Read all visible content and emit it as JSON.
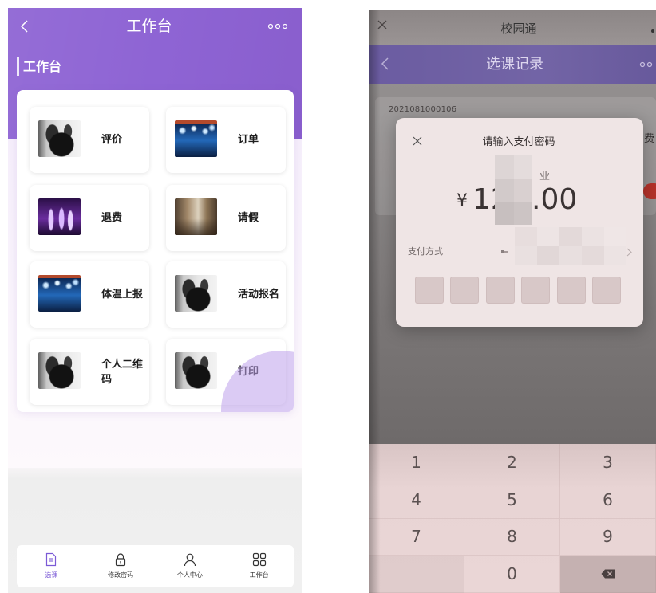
{
  "left_phone": {
    "header": {
      "back_icon": "chevron-left-icon",
      "title": "工作台",
      "more_icon": "more-dots-icon"
    },
    "section_title": "工作台",
    "grid": [
      {
        "label": "评价",
        "image": "camera-photo"
      },
      {
        "label": "订单",
        "image": "stage-photo"
      },
      {
        "label": "退费",
        "image": "dance-photo"
      },
      {
        "label": "请假",
        "image": "interior-photo"
      },
      {
        "label": "体温上报",
        "image": "stage-photo"
      },
      {
        "label": "活动报名",
        "image": "camera-photo"
      },
      {
        "label": "个人二维码",
        "image": "camera-photo"
      },
      {
        "label": "打印",
        "image": "camera-photo"
      }
    ],
    "bottom_nav": [
      {
        "label": "选课",
        "icon": "document-icon",
        "active": true
      },
      {
        "label": "修改密码",
        "icon": "lock-icon",
        "active": false
      },
      {
        "label": "个人中心",
        "icon": "person-icon",
        "active": false
      },
      {
        "label": "工作台",
        "icon": "grid-icon",
        "active": false
      }
    ]
  },
  "right_phone": {
    "app_bar": {
      "close_icon": "close-icon",
      "title": "校园通"
    },
    "header": {
      "back_icon": "chevron-left-icon",
      "title": "选课记录",
      "more_icon": "more-dots-icon"
    },
    "record": {
      "number": "2021081000106",
      "partial_label": "费"
    },
    "payment_dialog": {
      "close_icon": "close-icon",
      "title": "请输入支付密码",
      "merchant_visible": "业",
      "currency": "¥",
      "amount_visible_left": "12",
      "amount_visible_right": ".00",
      "payment_method_label": "支付方式",
      "arrow_icon": "chevron-right-icon",
      "password_digits": 6
    },
    "keypad": {
      "keys": [
        "1",
        "2",
        "3",
        "4",
        "5",
        "6",
        "7",
        "8",
        "9",
        "0"
      ],
      "delete_icon": "backspace-icon"
    }
  },
  "colors": {
    "left_header_purple": "#8e64d4",
    "nav_active": "#7b5ad6",
    "right_header_purple": "#6b5ca1",
    "dialog_background": "#efe5e5"
  }
}
